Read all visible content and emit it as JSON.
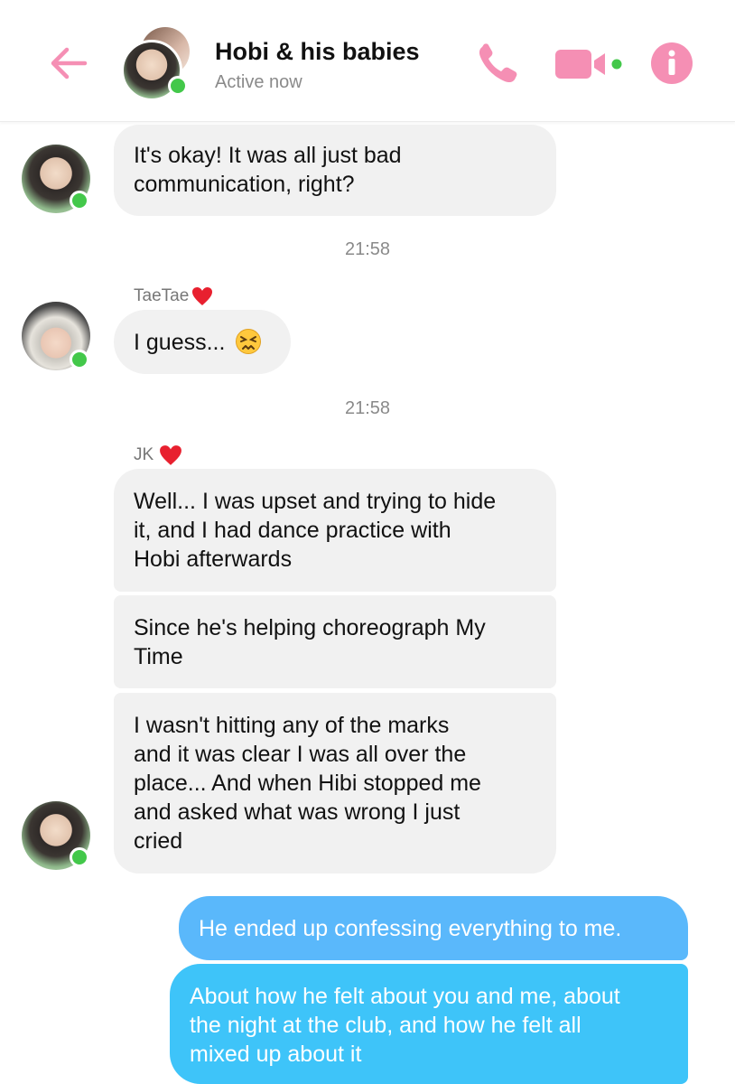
{
  "header": {
    "title": "Hobi & his babies",
    "status": "Active now",
    "icons": {
      "back": "back-arrow-icon",
      "call": "phone-icon",
      "video": "video-camera-icon",
      "info": "info-icon"
    },
    "accent_color": "#f58fb4"
  },
  "messages": {
    "m1": {
      "lines": [
        "It's okay! It was all just bad",
        "communication, right?"
      ]
    },
    "t1": "21:58",
    "taetae": {
      "sender": "TaeTae",
      "text": "I guess...",
      "emoji": "persevering-face"
    },
    "t2": "21:58",
    "jk": {
      "sender": "JK",
      "b1": [
        "Well... I was upset and trying to hide",
        "it, and I had dance practice with",
        "Hobi afterwards"
      ],
      "b2": [
        "Since he's helping choreograph My",
        "Time"
      ],
      "b3": [
        "I wasn't hitting any of the marks",
        "and it was clear I was all over the",
        "place... And when Hibi stopped me",
        "and asked what was wrong I just",
        "cried"
      ]
    },
    "out1": "He ended up confessing everything to me.",
    "out2": [
      "About how he felt about you and me, about",
      "the night at the club, and how he felt all",
      "mixed up about it"
    ]
  },
  "colors": {
    "incoming_bubble": "#f1f1f1",
    "outgoing_light": "#5ab8fb",
    "outgoing_dark": "#3ec4f9",
    "online": "#43c84a",
    "heart": "#e8202f"
  }
}
